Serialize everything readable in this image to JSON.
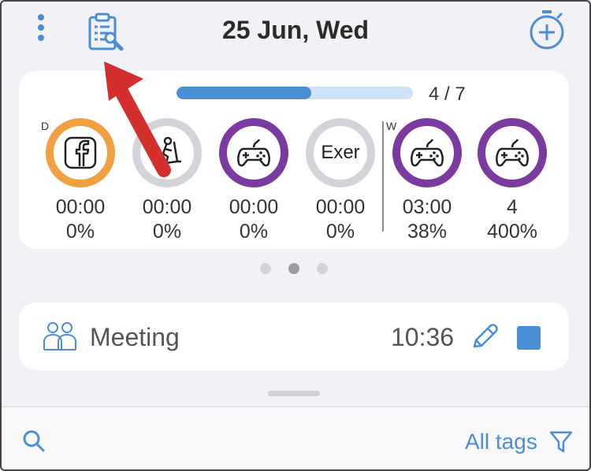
{
  "header": {
    "title": "25 Jun, Wed",
    "icons": [
      "more-vertical-icon",
      "clipboard-wrench-icon",
      "add-timer-icon"
    ]
  },
  "progress": {
    "count_label": "4 / 7",
    "fraction": 0.57
  },
  "sections": {
    "daily": "D",
    "weekly": "W"
  },
  "goals": [
    {
      "icon": "facebook-icon",
      "ring_color": "#f0a040",
      "time": "00:00",
      "percent": "0%"
    },
    {
      "icon": "treadmill-icon",
      "ring_color": "#d2d4da",
      "time": "00:00",
      "percent": "0%"
    },
    {
      "icon": "gamepad-icon",
      "ring_color": "#7a3aa0",
      "time": "00:00",
      "percent": "0%"
    },
    {
      "icon": "",
      "ring_text": "Exer",
      "ring_color": "#d2d4da",
      "time": "00:00",
      "percent": "0%"
    },
    {
      "icon": "gamepad-icon",
      "ring_color": "#7a3aa0",
      "time": "03:00",
      "percent": "38%"
    },
    {
      "icon": "gamepad-icon",
      "ring_color": "#7a3aa0",
      "time": "4",
      "percent": "400%"
    }
  ],
  "pager": {
    "count": 3,
    "active_index": 1
  },
  "activity": {
    "name": "Meeting",
    "time": "10:36",
    "icon": "people-icon",
    "color": "#4a8fd6"
  },
  "bottom_bar": {
    "tags_label": "All tags"
  },
  "colors": {
    "accent": "#4a8fd6",
    "progress_track": "#cfe2f6",
    "background": "#f2f1f6",
    "annotation": "#d32f2f"
  }
}
